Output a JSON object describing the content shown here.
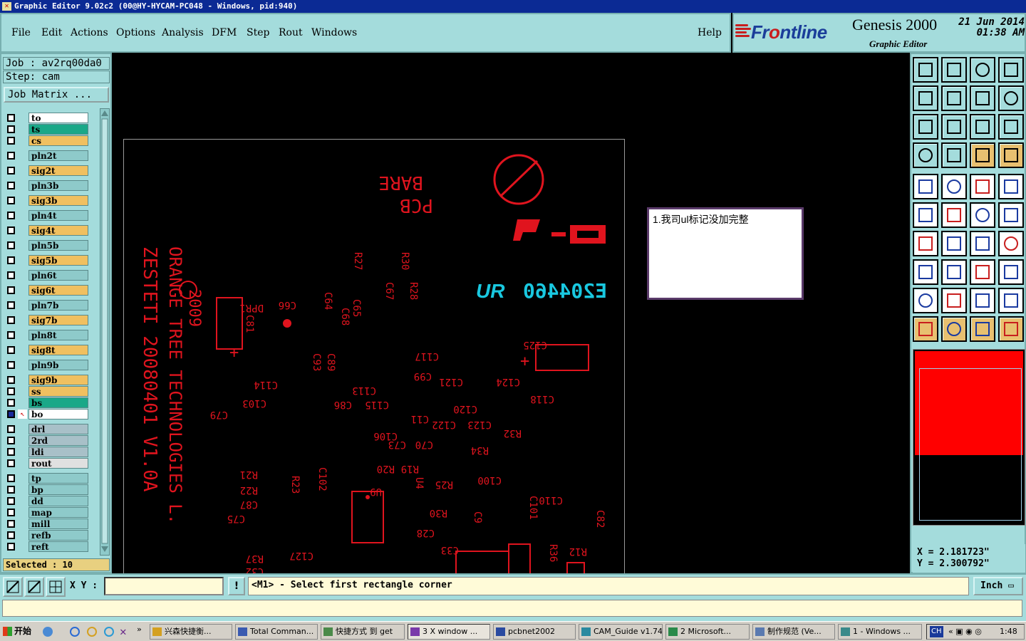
{
  "window": {
    "title": "Graphic Editor 9.02c2 (00@HY-HYCAM-PC048 - Windows, pid:940)"
  },
  "menu": {
    "items": [
      "File",
      "Edit",
      "Actions",
      "Options",
      "Analysis",
      "DFM",
      "Step",
      "Rout",
      "Windows"
    ],
    "help": "Help"
  },
  "brand": {
    "logo_front": "Fr",
    "logo_o": "o",
    "logo_rest": "ntline",
    "product": "Genesis 2000",
    "subtitle": "Graphic Editor",
    "date": "21 Jun 2014",
    "time": "01:38 AM"
  },
  "job": {
    "job_line": "Job : av2rq00da0",
    "step_line": "Step: cam",
    "matrix_button": "Job Matrix ..."
  },
  "layers": [
    {
      "name": "to",
      "color": "#ffffff"
    },
    {
      "name": "ts",
      "color": "#1aa888"
    },
    {
      "name": "cs",
      "color": "#f0c060"
    },
    {
      "name": "pln2t",
      "color": "#8ecaca"
    },
    {
      "name": "sig2t",
      "color": "#f0c060"
    },
    {
      "name": "pln3b",
      "color": "#8ecaca"
    },
    {
      "name": "sig3b",
      "color": "#f0c060"
    },
    {
      "name": "pln4t",
      "color": "#8ecaca"
    },
    {
      "name": "sig4t",
      "color": "#f0c060"
    },
    {
      "name": "pln5b",
      "color": "#8ecaca"
    },
    {
      "name": "sig5b",
      "color": "#f0c060"
    },
    {
      "name": "pln6t",
      "color": "#8ecaca"
    },
    {
      "name": "sig6t",
      "color": "#f0c060"
    },
    {
      "name": "pln7b",
      "color": "#8ecaca"
    },
    {
      "name": "sig7b",
      "color": "#f0c060"
    },
    {
      "name": "pln8t",
      "color": "#8ecaca"
    },
    {
      "name": "sig8t",
      "color": "#f0c060"
    },
    {
      "name": "pln9b",
      "color": "#8ecaca"
    },
    {
      "name": "sig9b",
      "color": "#f0c060"
    },
    {
      "name": "ss",
      "color": "#f0c060"
    },
    {
      "name": "bs",
      "color": "#1aa888"
    },
    {
      "name": "bo",
      "color": "#ffffff"
    },
    {
      "name": "drl",
      "color": "#a8c0c8"
    },
    {
      "name": "2rd",
      "color": "#a8c0c8"
    },
    {
      "name": "ldi",
      "color": "#a8c0c8"
    },
    {
      "name": "rout",
      "color": "#e0e0e0"
    },
    {
      "name": "tp",
      "color": "#8ecaca"
    },
    {
      "name": "bp",
      "color": "#8ecaca"
    },
    {
      "name": "dd",
      "color": "#8ecaca"
    },
    {
      "name": "map",
      "color": "#8ecaca"
    },
    {
      "name": "mill",
      "color": "#8ecaca"
    },
    {
      "name": "refb",
      "color": "#8ecaca"
    },
    {
      "name": "reft",
      "color": "#8ecaca"
    }
  ],
  "selected": "Selected : 10",
  "board": {
    "silk_text": [
      "BARE",
      "PCB",
      "ZESTETI 20080401 V1.0A",
      "ORANGE TREE TECHNOLOGIES L.",
      "2009",
      "E204460",
      "DPR1",
      "C66",
      "C64",
      "C65",
      "R27",
      "R30",
      "C67",
      "R28",
      "C68",
      "C81",
      "C125",
      "C117",
      "C118",
      "C124",
      "C121",
      "C99",
      "C114",
      "C93",
      "C89",
      "C103",
      "C79",
      "C86",
      "C115",
      "C113",
      "C120",
      "C122",
      "C123",
      "C11",
      "R32",
      "C106",
      "C73",
      "C70",
      "R34",
      "R21",
      "R22",
      "C87",
      "C75",
      "R23",
      "C102",
      "R20",
      "R19",
      "R25",
      "U4",
      "U9",
      "C110",
      "C100",
      "C101",
      "C82",
      "R12",
      "C28",
      "R30",
      "C9",
      "C33",
      "R36",
      "R37",
      "C32",
      "C127"
    ],
    "note": "1.我司ul标记没加完整"
  },
  "coords": {
    "x": "X = 2.181723\"",
    "y": "Y = 2.300792\""
  },
  "command": {
    "xy_label": "X Y :",
    "xy_value": "",
    "prompt": "<M1> - Select first rectangle corner",
    "unit": "Inch"
  },
  "minimap": {
    "red_fill_fraction": 0.6
  },
  "taskbar": {
    "start": "开始",
    "tasks": [
      "兴森快捷衡...",
      "Total Comman...",
      "快捷方式 到 get",
      "3 X window ...",
      "pcbnet2002",
      "CAM_Guide v1.74",
      "2 Microsoft...",
      "制作规范 (Ve...",
      "1 - Windows ..."
    ],
    "clock": "1:48",
    "lang": "CH"
  }
}
